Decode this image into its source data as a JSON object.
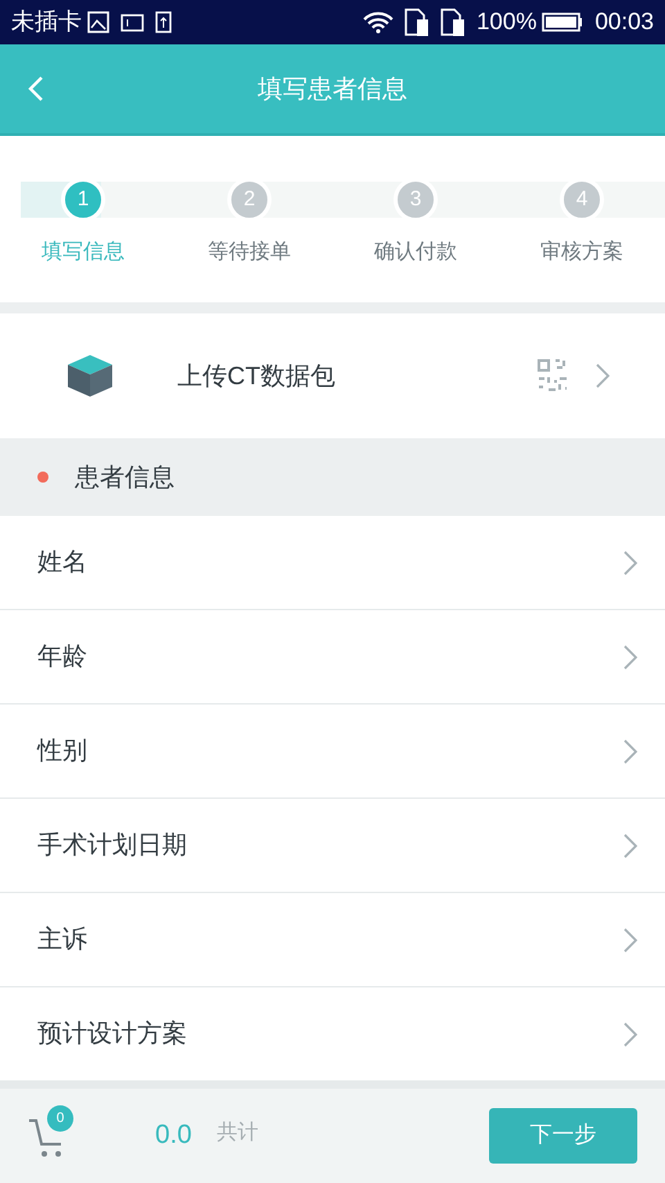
{
  "status_bar": {
    "carrier": "未插卡",
    "battery": "100%",
    "time": "00:03"
  },
  "header": {
    "title": "填写患者信息"
  },
  "steps": [
    {
      "number": "1",
      "label": "填写信息",
      "selected": true
    },
    {
      "number": "2",
      "label": "等待接单",
      "selected": false
    },
    {
      "number": "3",
      "label": "确认付款",
      "selected": false
    },
    {
      "number": "4",
      "label": "审核方案",
      "selected": false
    }
  ],
  "upload": {
    "label": "上传CT数据包"
  },
  "section": {
    "title": "患者信息",
    "color": "#f26b5b"
  },
  "fields": [
    {
      "label": "姓名"
    },
    {
      "label": "年龄"
    },
    {
      "label": "性别"
    },
    {
      "label": "手术计划日期"
    },
    {
      "label": "主诉"
    },
    {
      "label": "预计设计方案"
    }
  ],
  "footer": {
    "cart_count": "0",
    "amount": "0.0",
    "total_label": "共计",
    "next_button": "下一步"
  }
}
